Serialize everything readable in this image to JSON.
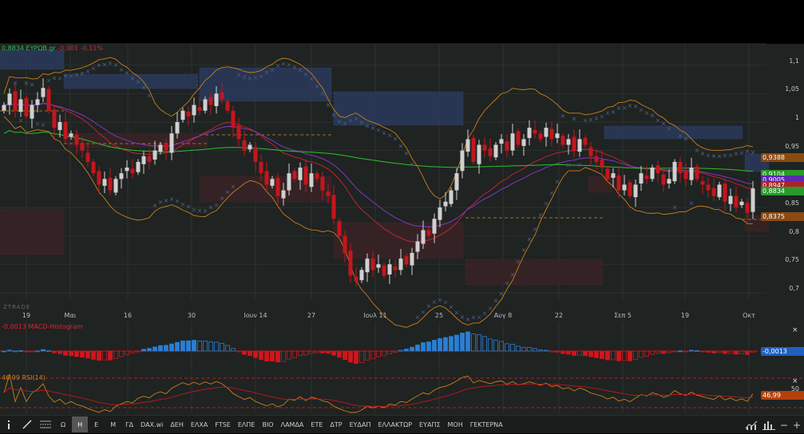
{
  "legend": {
    "price": "0,8834",
    "symbol": "ΕΥΡΩΒ.gr",
    "change": "-0,001",
    "change_pct": "-0,11%"
  },
  "watermark": "ZTRADE",
  "price_axis": [
    "1,1",
    "1,05",
    "1",
    "0,95",
    "0,85",
    "0,8",
    "0,75",
    "0,7"
  ],
  "price_badges": [
    {
      "label": "0,9388",
      "color": "#8a4a12"
    },
    {
      "label": "0,9104",
      "color": "#2a9a2a"
    },
    {
      "label": "0,9005",
      "color": "#5a2ab0"
    },
    {
      "label": "0,8947",
      "color": "#b0202a"
    },
    {
      "label": "0,8834",
      "color": "#2a9a2a"
    },
    {
      "label": "0,8375",
      "color": "#8a4a12"
    }
  ],
  "x_axis": [
    "19",
    "Μαι",
    "16",
    "30",
    "Ιουν 14",
    "27",
    "Ιουλ 11",
    "25",
    "Αυγ 8",
    "22",
    "Σεπ 5",
    "19",
    "Οκτ"
  ],
  "macd": {
    "label": "-0,0013 MACD-Histogram",
    "value": "-0,0013"
  },
  "rsi": {
    "label": "46.99 RSI(14)",
    "value": "46,99",
    "level": "50"
  },
  "close_symbol": "×",
  "toolbar": {
    "icons": [
      "info-icon",
      "draw-line-icon",
      "indicators-icon"
    ],
    "buttons": [
      "Ω",
      "H",
      "E",
      "M",
      "ΓΔ",
      "DAX.wi",
      "ΔΕΗ",
      "ΕΛΧΑ",
      "FTSE",
      "ΕΛΠΕ",
      "ΒΙΟ",
      "ΛΑΜΔΑ",
      "ΕΤΕ",
      "ΔΤΡ",
      "ΕΥΔΑΠ",
      "ΕΛΛΑΚΤΩΡ",
      "ΕΥΑΠΣ",
      "ΜΟΗ",
      "ΓΕΚΤΕΡΝΑ"
    ],
    "active": "H",
    "zoom_out": "−",
    "zoom_in": "+"
  },
  "colors": {
    "up": "#d0d0d0",
    "down": "#c4161c",
    "bollinger": "#c87f1a",
    "ema_fast": "#d0262e",
    "ema_slow": "#8a3ad0",
    "sma_long": "#2fc02f",
    "macd_pos": "#2a7fd4",
    "macd_neg": "#d0161c",
    "rsi": "#c87f1a",
    "rsi_ma": "#c4161c"
  },
  "chart_data": {
    "type": "candlestick",
    "symbol": "ΕΥΡΩΒ.gr",
    "ylim": [
      0.68,
      1.13
    ],
    "close": [
      1.03,
      1.05,
      1.02,
      1.04,
      1.01,
      1.03,
      1.04,
      1.06,
      1.02,
      0.99,
      1.0,
      0.97,
      0.98,
      0.96,
      0.95,
      0.93,
      0.91,
      0.89,
      0.9,
      0.88,
      0.9,
      0.91,
      0.92,
      0.91,
      0.93,
      0.94,
      0.93,
      0.95,
      0.96,
      0.95,
      0.98,
      1.0,
      1.02,
      1.01,
      1.03,
      1.02,
      1.04,
      1.03,
      1.05,
      1.04,
      1.02,
      0.99,
      0.97,
      0.95,
      0.96,
      0.93,
      0.91,
      0.89,
      0.9,
      0.87,
      0.88,
      0.91,
      0.9,
      0.92,
      0.89,
      0.91,
      0.9,
      0.88,
      0.87,
      0.83,
      0.8,
      0.77,
      0.73,
      0.72,
      0.74,
      0.76,
      0.74,
      0.75,
      0.73,
      0.75,
      0.74,
      0.76,
      0.75,
      0.77,
      0.79,
      0.81,
      0.8,
      0.83,
      0.85,
      0.86,
      0.88,
      0.91,
      0.95,
      0.97,
      0.93,
      0.96,
      0.95,
      0.94,
      0.96,
      0.97,
      0.95,
      0.98,
      0.96,
      0.97,
      0.99,
      0.98,
      0.97,
      0.99,
      0.97,
      0.98,
      0.96,
      0.97,
      0.95,
      0.97,
      0.96,
      0.94,
      0.93,
      0.92,
      0.9,
      0.91,
      0.88,
      0.89,
      0.87,
      0.89,
      0.91,
      0.9,
      0.92,
      0.91,
      0.89,
      0.9,
      0.93,
      0.91,
      0.9,
      0.92,
      0.9,
      0.89,
      0.88,
      0.87,
      0.89,
      0.86,
      0.87,
      0.85,
      0.86,
      0.84,
      0.8834
    ],
    "indicators": [
      "Bollinger Bands",
      "EMA",
      "EMA",
      "SMA",
      "Parabolic SAR",
      "MACD-Histogram",
      "RSI(14)"
    ]
  }
}
